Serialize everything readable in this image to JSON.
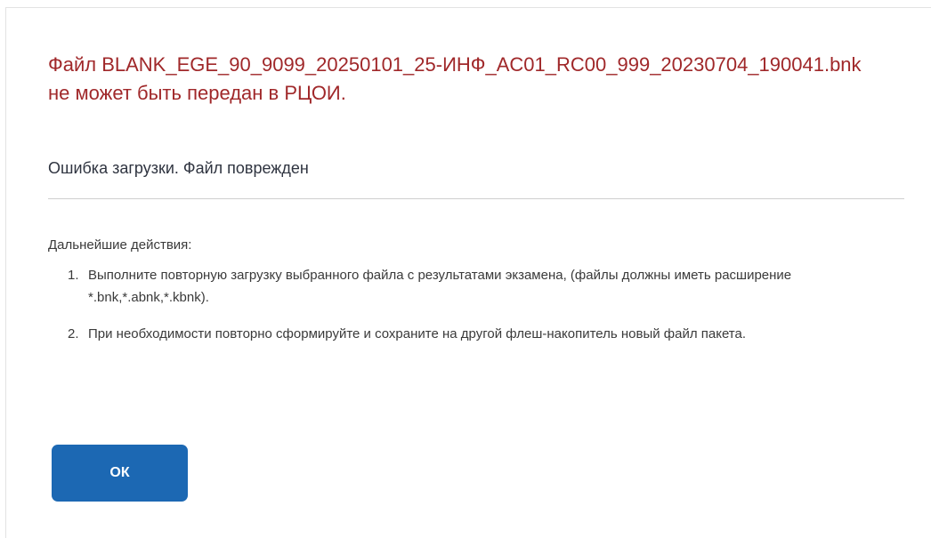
{
  "dialog": {
    "title": "Файл BLANK_EGE_90_9099_20250101_25-ИНФ_AC01_RC00_999_20230704_190041.bnk не может быть передан в РЦОИ.",
    "subtitle": "Ошибка загрузки. Файл поврежден",
    "actions_label": "Дальнейшие действия:",
    "steps": [
      {
        "number": "1.",
        "text": "Выполните повторную загрузку выбранного файла с результатами экзамена, (файлы должны иметь расширение *.bnk,*.abnk,*.kbnk)."
      },
      {
        "number": "2.",
        "text": "При необходимости повторно сформируйте и сохраните на другой флеш-накопитель новый файл пакета."
      }
    ],
    "ok_label": "ОК"
  },
  "colors": {
    "title": "#a0282a",
    "button": "#1c68b3",
    "button_text": "#ffffff"
  }
}
